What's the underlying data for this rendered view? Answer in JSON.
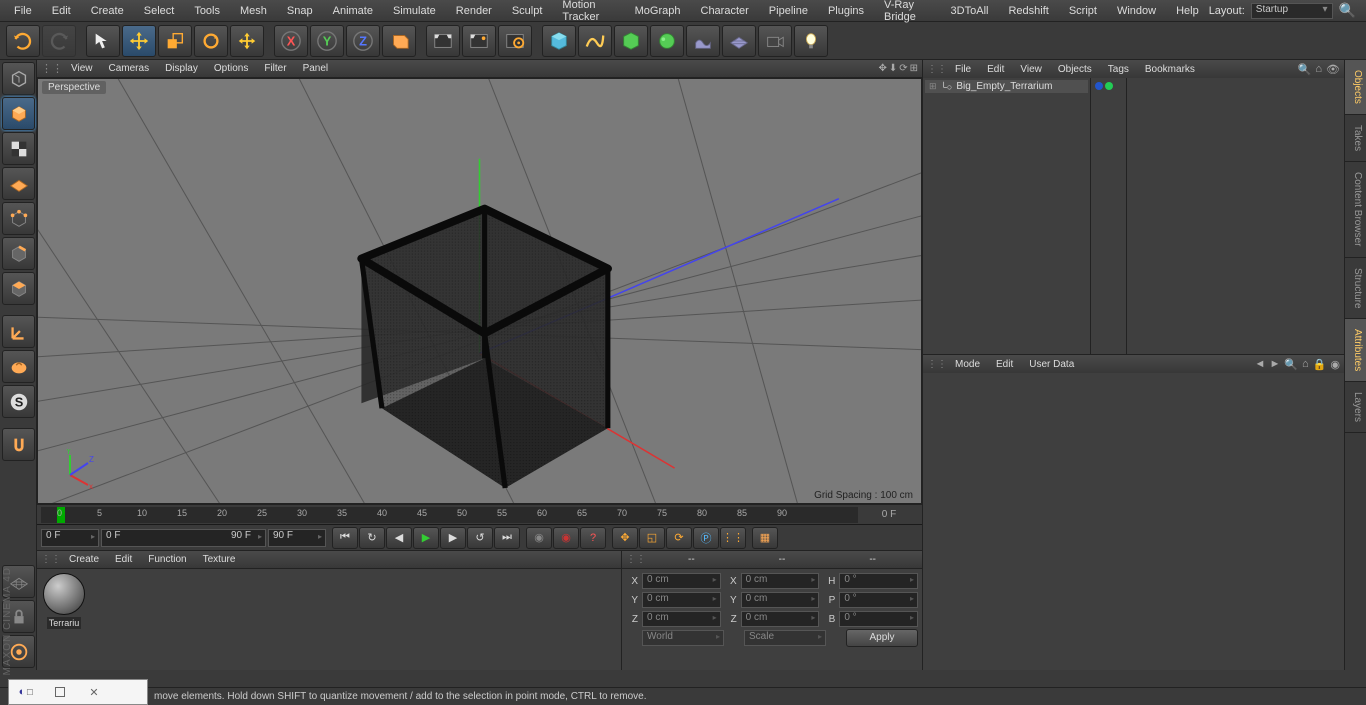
{
  "menubar": [
    "File",
    "Edit",
    "Create",
    "Select",
    "Tools",
    "Mesh",
    "Snap",
    "Animate",
    "Simulate",
    "Render",
    "Sculpt",
    "Motion Tracker",
    "MoGraph",
    "Character",
    "Pipeline",
    "Plugins",
    "V-Ray Bridge",
    "3DToAll",
    "Redshift",
    "Script",
    "Window",
    "Help"
  ],
  "layout_label": "Layout:",
  "layout_value": "Startup",
  "viewport_menus": [
    "View",
    "Cameras",
    "Display",
    "Options",
    "Filter",
    "Panel"
  ],
  "viewport_label": "Perspective",
  "grid_spacing": "Grid Spacing : 100 cm",
  "timeline": {
    "ticks": [
      0,
      5,
      10,
      15,
      20,
      25,
      30,
      35,
      40,
      45,
      50,
      55,
      60,
      65,
      70,
      75,
      80,
      85,
      90
    ],
    "current_display": "0 F"
  },
  "playbar": {
    "start": "0 F",
    "range_start": "0 F",
    "range_end": "90 F",
    "end": "90 F"
  },
  "material_panel_menus": [
    "Create",
    "Edit",
    "Function",
    "Texture"
  ],
  "material_name": "Terrariu",
  "coords": {
    "header": [
      "--",
      "--",
      "--"
    ],
    "rows": [
      {
        "l": "X",
        "a": "0 cm",
        "b": "X",
        "c": "0 cm",
        "d": "H",
        "e": "0 °"
      },
      {
        "l": "Y",
        "a": "0 cm",
        "b": "Y",
        "c": "0 cm",
        "d": "P",
        "e": "0 °"
      },
      {
        "l": "Z",
        "a": "0 cm",
        "b": "Z",
        "c": "0 cm",
        "d": "B",
        "e": "0 °"
      }
    ],
    "mode1": "World",
    "mode2": "Scale",
    "apply": "Apply"
  },
  "obj_panel_menus": [
    "File",
    "Edit",
    "View",
    "Objects",
    "Tags",
    "Bookmarks"
  ],
  "object_name": "Big_Empty_Terrarium",
  "attr_panel_menus": [
    "Mode",
    "Edit",
    "User Data"
  ],
  "right_tabs": [
    "Objects",
    "Takes",
    "Content Browser",
    "Structure",
    "Attributes",
    "Layers"
  ],
  "status_hint": "move elements. Hold down SHIFT to quantize movement / add to the selection in point mode, CTRL to remove.",
  "brand": "MAXON CINEMA 4D"
}
